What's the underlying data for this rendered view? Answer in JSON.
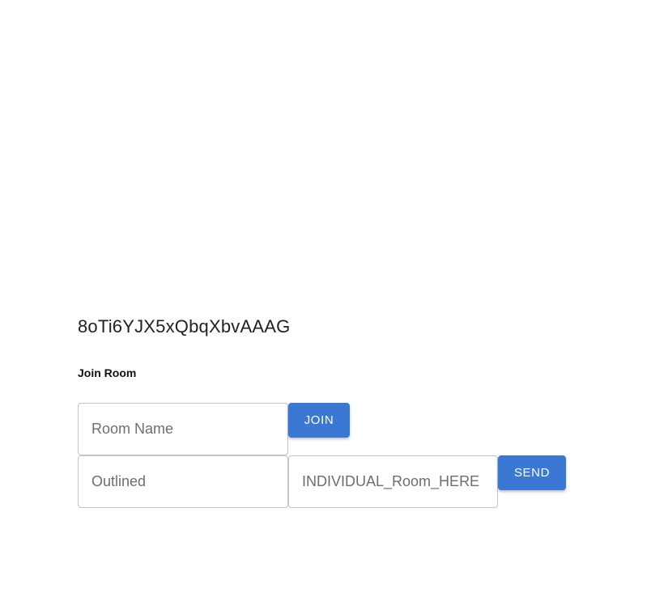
{
  "socket_id": "8oTi6YJX5xQbqXbvAAAG",
  "join_section": {
    "title": "Join Room",
    "room_name_placeholder": "Room Name",
    "join_label": "JOIN"
  },
  "message_section": {
    "message_placeholder": "Outlined",
    "target_placeholder": "INDIVIDUAL_Room_HERE",
    "send_label": "SEND"
  },
  "colors": {
    "button": "#3a78d4",
    "border": "#c4c4c4"
  }
}
